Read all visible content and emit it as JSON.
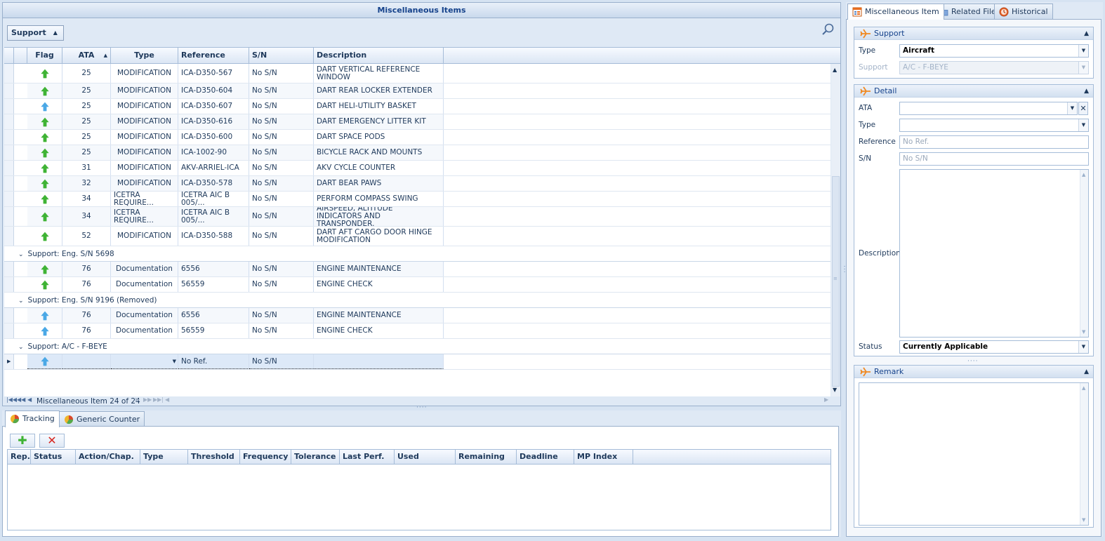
{
  "main": {
    "title": "Miscellaneous Items",
    "group_by_label": "Support",
    "columns": [
      "Flag",
      "ATA",
      "Type",
      "Reference",
      "S/N",
      "Description"
    ],
    "sort_column": "ATA",
    "rows_top": [
      {
        "flag": "green",
        "ata": "25",
        "type": "MODIFICATION",
        "ref": "ICA-D350-567",
        "sn": "No S/N",
        "desc": "DART VERTICAL REFERENCE WINDOW"
      },
      {
        "flag": "green",
        "ata": "25",
        "type": "MODIFICATION",
        "ref": "ICA-D350-604",
        "sn": "No S/N",
        "desc": "DART REAR LOCKER EXTENDER"
      },
      {
        "flag": "blue",
        "ata": "25",
        "type": "MODIFICATION",
        "ref": "ICA-D350-607",
        "sn": "No S/N",
        "desc": "DART HELI-UTILITY BASKET"
      },
      {
        "flag": "green",
        "ata": "25",
        "type": "MODIFICATION",
        "ref": "ICA-D350-616",
        "sn": "No S/N",
        "desc": "DART EMERGENCY LITTER KIT"
      },
      {
        "flag": "green",
        "ata": "25",
        "type": "MODIFICATION",
        "ref": "ICA-D350-600",
        "sn": "No S/N",
        "desc": "DART SPACE PODS"
      },
      {
        "flag": "green",
        "ata": "25",
        "type": "MODIFICATION",
        "ref": "ICA-1002-90",
        "sn": "No S/N",
        "desc": "BICYCLE RACK AND MOUNTS"
      },
      {
        "flag": "green",
        "ata": "31",
        "type": "MODIFICATION",
        "ref": "AKV-ARRIEL-ICA",
        "sn": "No S/N",
        "desc": "AKV CYCLE COUNTER"
      },
      {
        "flag": "green",
        "ata": "32",
        "type": "MODIFICATION",
        "ref": "ICA-D350-578",
        "sn": "No S/N",
        "desc": "DART BEAR PAWS"
      },
      {
        "flag": "green",
        "ata": "34",
        "type": "ICETRA REQUIRE...",
        "ref": "ICETRA AIC B 005/...",
        "sn": "No S/N",
        "desc": "PERFORM COMPASS SWING"
      },
      {
        "flag": "green",
        "ata": "34",
        "type": "ICETRA REQUIRE...",
        "ref": "ICETRA AIC B 005/...",
        "sn": "No S/N",
        "desc": "AIRSPEED, ALTITUDE INDICATORS AND TRANSPONDER."
      },
      {
        "flag": "green",
        "ata": "52",
        "type": "MODIFICATION",
        "ref": "ICA-D350-588",
        "sn": "No S/N",
        "desc": "DART AFT CARGO DOOR HINGE MODIFICATION"
      }
    ],
    "group1": {
      "label": "Support: Eng. S/N 5698",
      "rows": [
        {
          "flag": "green",
          "ata": "76",
          "type": "Documentation",
          "ref": "6556",
          "sn": "No S/N",
          "desc": "ENGINE MAINTENANCE"
        },
        {
          "flag": "green",
          "ata": "76",
          "type": "Documentation",
          "ref": "56559",
          "sn": "No S/N",
          "desc": "ENGINE CHECK"
        }
      ]
    },
    "group2": {
      "label": "Support: Eng. S/N 9196 (Removed)",
      "rows": [
        {
          "flag": "blue",
          "ata": "76",
          "type": "Documentation",
          "ref": "6556",
          "sn": "No S/N",
          "desc": "ENGINE MAINTENANCE"
        },
        {
          "flag": "blue",
          "ata": "76",
          "type": "Documentation",
          "ref": "56559",
          "sn": "No S/N",
          "desc": "ENGINE CHECK"
        }
      ]
    },
    "group3": {
      "label": "Support: A/C - F-BEYE",
      "new_row": {
        "flag": "blue",
        "ref": "No Ref.",
        "sn": "No S/N"
      }
    },
    "navigator_text": "Miscellaneous Item 24 of 24"
  },
  "bottom": {
    "tabs": [
      "Tracking",
      "Generic Counter"
    ],
    "columns": [
      "Rep.",
      "Status",
      "Action/Chap.",
      "Type",
      "Threshold",
      "Frequency",
      "Tolerance",
      "Last Perf.",
      "Used",
      "Remaining",
      "Deadline",
      "MP Index"
    ]
  },
  "right": {
    "tabs": [
      "Miscellaneous Item",
      "Related Files",
      "Historical"
    ],
    "support_section": {
      "title": "Support",
      "type_label": "Type",
      "type_value": "Aircraft",
      "support_label": "Support",
      "support_value": "A/C - F-BEYE"
    },
    "detail_section": {
      "title": "Detail",
      "ata_label": "ATA",
      "type_label": "Type",
      "reference_label": "Reference",
      "reference_placeholder": "No Ref.",
      "sn_label": "S/N",
      "sn_placeholder": "No S/N",
      "description_label": "Description",
      "status_label": "Status",
      "status_value": "Currently Applicable"
    },
    "remark_section": {
      "title": "Remark"
    }
  },
  "colors": {
    "flag_green": "#3fb335",
    "flag_blue": "#4aa8e6",
    "accent_orange": "#f08a24"
  }
}
